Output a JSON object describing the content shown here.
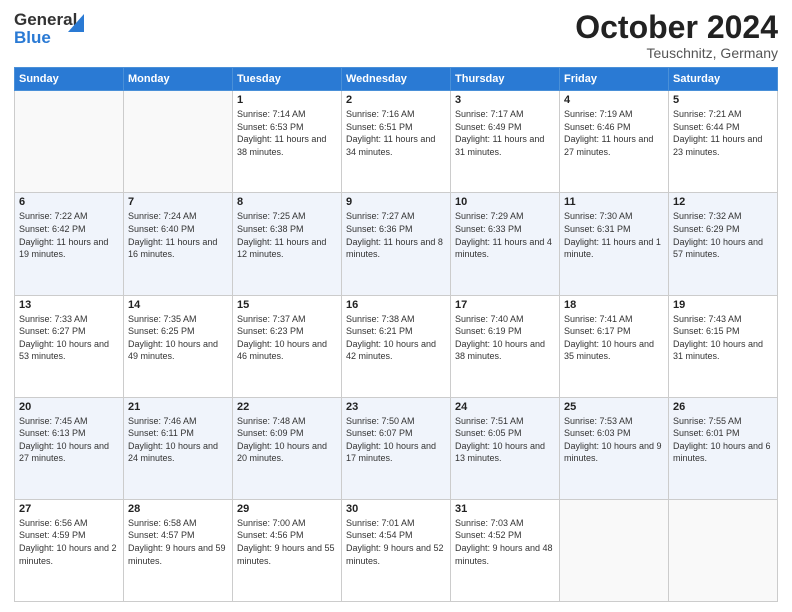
{
  "header": {
    "logo_line1": "General",
    "logo_line2": "Blue",
    "month": "October 2024",
    "location": "Teuschnitz, Germany"
  },
  "weekdays": [
    "Sunday",
    "Monday",
    "Tuesday",
    "Wednesday",
    "Thursday",
    "Friday",
    "Saturday"
  ],
  "weeks": [
    [
      {
        "day": "",
        "info": ""
      },
      {
        "day": "",
        "info": ""
      },
      {
        "day": "1",
        "info": "Sunrise: 7:14 AM\nSunset: 6:53 PM\nDaylight: 11 hours\nand 38 minutes."
      },
      {
        "day": "2",
        "info": "Sunrise: 7:16 AM\nSunset: 6:51 PM\nDaylight: 11 hours\nand 34 minutes."
      },
      {
        "day": "3",
        "info": "Sunrise: 7:17 AM\nSunset: 6:49 PM\nDaylight: 11 hours\nand 31 minutes."
      },
      {
        "day": "4",
        "info": "Sunrise: 7:19 AM\nSunset: 6:46 PM\nDaylight: 11 hours\nand 27 minutes."
      },
      {
        "day": "5",
        "info": "Sunrise: 7:21 AM\nSunset: 6:44 PM\nDaylight: 11 hours\nand 23 minutes."
      }
    ],
    [
      {
        "day": "6",
        "info": "Sunrise: 7:22 AM\nSunset: 6:42 PM\nDaylight: 11 hours\nand 19 minutes."
      },
      {
        "day": "7",
        "info": "Sunrise: 7:24 AM\nSunset: 6:40 PM\nDaylight: 11 hours\nand 16 minutes."
      },
      {
        "day": "8",
        "info": "Sunrise: 7:25 AM\nSunset: 6:38 PM\nDaylight: 11 hours\nand 12 minutes."
      },
      {
        "day": "9",
        "info": "Sunrise: 7:27 AM\nSunset: 6:36 PM\nDaylight: 11 hours\nand 8 minutes."
      },
      {
        "day": "10",
        "info": "Sunrise: 7:29 AM\nSunset: 6:33 PM\nDaylight: 11 hours\nand 4 minutes."
      },
      {
        "day": "11",
        "info": "Sunrise: 7:30 AM\nSunset: 6:31 PM\nDaylight: 11 hours\nand 1 minute."
      },
      {
        "day": "12",
        "info": "Sunrise: 7:32 AM\nSunset: 6:29 PM\nDaylight: 10 hours\nand 57 minutes."
      }
    ],
    [
      {
        "day": "13",
        "info": "Sunrise: 7:33 AM\nSunset: 6:27 PM\nDaylight: 10 hours\nand 53 minutes."
      },
      {
        "day": "14",
        "info": "Sunrise: 7:35 AM\nSunset: 6:25 PM\nDaylight: 10 hours\nand 49 minutes."
      },
      {
        "day": "15",
        "info": "Sunrise: 7:37 AM\nSunset: 6:23 PM\nDaylight: 10 hours\nand 46 minutes."
      },
      {
        "day": "16",
        "info": "Sunrise: 7:38 AM\nSunset: 6:21 PM\nDaylight: 10 hours\nand 42 minutes."
      },
      {
        "day": "17",
        "info": "Sunrise: 7:40 AM\nSunset: 6:19 PM\nDaylight: 10 hours\nand 38 minutes."
      },
      {
        "day": "18",
        "info": "Sunrise: 7:41 AM\nSunset: 6:17 PM\nDaylight: 10 hours\nand 35 minutes."
      },
      {
        "day": "19",
        "info": "Sunrise: 7:43 AM\nSunset: 6:15 PM\nDaylight: 10 hours\nand 31 minutes."
      }
    ],
    [
      {
        "day": "20",
        "info": "Sunrise: 7:45 AM\nSunset: 6:13 PM\nDaylight: 10 hours\nand 27 minutes."
      },
      {
        "day": "21",
        "info": "Sunrise: 7:46 AM\nSunset: 6:11 PM\nDaylight: 10 hours\nand 24 minutes."
      },
      {
        "day": "22",
        "info": "Sunrise: 7:48 AM\nSunset: 6:09 PM\nDaylight: 10 hours\nand 20 minutes."
      },
      {
        "day": "23",
        "info": "Sunrise: 7:50 AM\nSunset: 6:07 PM\nDaylight: 10 hours\nand 17 minutes."
      },
      {
        "day": "24",
        "info": "Sunrise: 7:51 AM\nSunset: 6:05 PM\nDaylight: 10 hours\nand 13 minutes."
      },
      {
        "day": "25",
        "info": "Sunrise: 7:53 AM\nSunset: 6:03 PM\nDaylight: 10 hours\nand 9 minutes."
      },
      {
        "day": "26",
        "info": "Sunrise: 7:55 AM\nSunset: 6:01 PM\nDaylight: 10 hours\nand 6 minutes."
      }
    ],
    [
      {
        "day": "27",
        "info": "Sunrise: 6:56 AM\nSunset: 4:59 PM\nDaylight: 10 hours\nand 2 minutes."
      },
      {
        "day": "28",
        "info": "Sunrise: 6:58 AM\nSunset: 4:57 PM\nDaylight: 9 hours\nand 59 minutes."
      },
      {
        "day": "29",
        "info": "Sunrise: 7:00 AM\nSunset: 4:56 PM\nDaylight: 9 hours\nand 55 minutes."
      },
      {
        "day": "30",
        "info": "Sunrise: 7:01 AM\nSunset: 4:54 PM\nDaylight: 9 hours\nand 52 minutes."
      },
      {
        "day": "31",
        "info": "Sunrise: 7:03 AM\nSunset: 4:52 PM\nDaylight: 9 hours\nand 48 minutes."
      },
      {
        "day": "",
        "info": ""
      },
      {
        "day": "",
        "info": ""
      }
    ]
  ]
}
